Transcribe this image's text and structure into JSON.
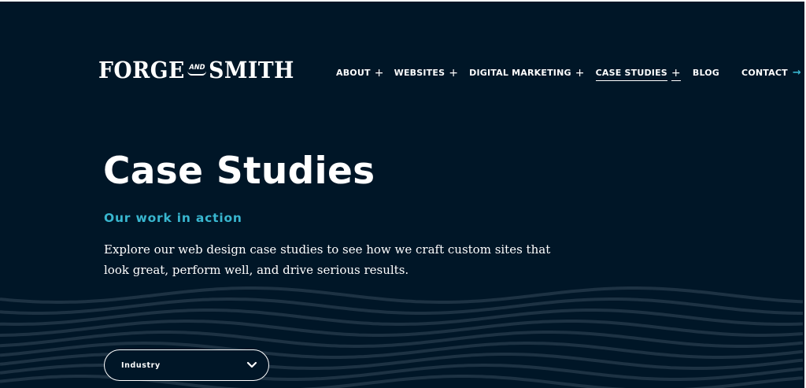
{
  "brand": {
    "word1": "FORGE",
    "and": "AND",
    "word2": "SMITH"
  },
  "nav": {
    "items": [
      {
        "label": "ABOUT",
        "has_submenu": true
      },
      {
        "label": "WEBSITES",
        "has_submenu": true
      },
      {
        "label": "DIGITAL MARKETING",
        "has_submenu": true
      },
      {
        "label": "CASE STUDIES",
        "has_submenu": true,
        "active": true
      },
      {
        "label": "BLOG",
        "has_submenu": false
      },
      {
        "label": "CONTACT",
        "has_submenu": false
      }
    ],
    "plus_symbol": "+",
    "contact_arrow": "→"
  },
  "hero": {
    "title": "Case Studies",
    "subtitle": "Our work in action",
    "description": "Explore our web design case studies to see how we craft custom sites that look great, perform well, and drive serious results."
  },
  "filter": {
    "label": "Industry"
  },
  "icons": {
    "plus": "plus-icon",
    "contact_arrow": "arrow-right-icon",
    "dropdown": "chevron-down-icon"
  },
  "colors": {
    "background": "#001627",
    "accent": "#38b6cf",
    "text": "#ffffff",
    "wave": "#1d3243"
  }
}
